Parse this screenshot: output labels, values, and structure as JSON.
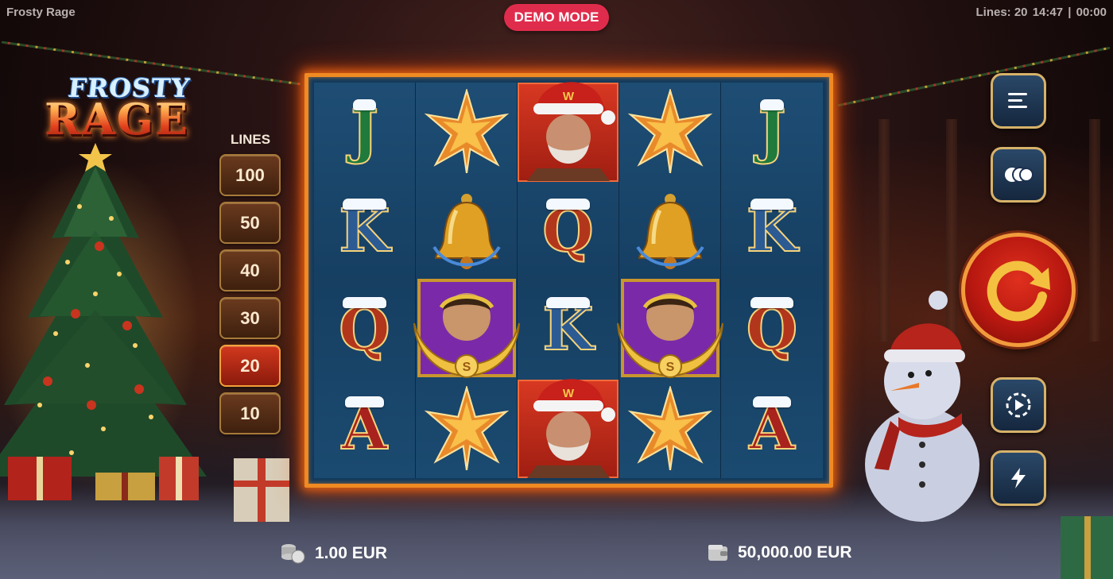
{
  "header": {
    "app_title": "Frosty Rage",
    "demo_label": "DEMO MODE",
    "lines_status": "Lines: 20",
    "clock": "14:47",
    "separator": "|",
    "timer": "00:00"
  },
  "logo": {
    "line1": "FROSTY",
    "line2": "RAGE"
  },
  "lines_panel": {
    "label": "LINES",
    "options": [
      "100",
      "50",
      "40",
      "30",
      "20",
      "10"
    ],
    "selected": "20"
  },
  "reels": [
    [
      "J",
      "K",
      "Q",
      "A"
    ],
    [
      "star",
      "bell",
      "laurel-hero",
      "star"
    ],
    [
      "santa-hero",
      "Q",
      "K",
      "santa-hero"
    ],
    [
      "star",
      "bell",
      "laurel-hero",
      "star"
    ],
    [
      "J",
      "K",
      "Q",
      "A"
    ]
  ],
  "symbol_badges": {
    "santa_hat_letter": "W",
    "laurel_coin_letter": "S"
  },
  "controls": {
    "menu_icon": "menu-icon",
    "autoplay_icon": "coins-toggle-icon",
    "spin_icon": "spin-arrow-icon",
    "auto_spin_icon": "auto-spin-icon",
    "turbo_icon": "turbo-icon"
  },
  "bottom": {
    "bet_value": "1.00 EUR",
    "balance_value": "50,000.00 EUR"
  },
  "colors": {
    "demo_badge": "#e02c4c",
    "frame_glow": "#f08a22",
    "line_active": "#d2381e",
    "reel_bg": "#1e4d74"
  }
}
